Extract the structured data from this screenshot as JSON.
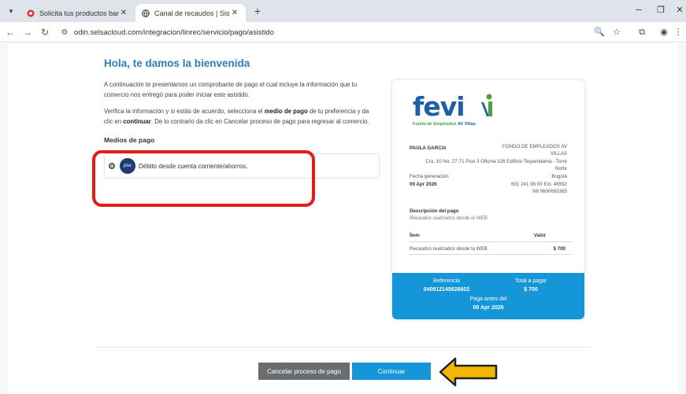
{
  "browser": {
    "tabs": [
      {
        "title": "Solicita tus productos bancarios",
        "active": false
      },
      {
        "title": "Canal de recaudos | Sistemas E",
        "active": true
      }
    ],
    "url": "odin.selsacloud.com/integracion/linrec/servicio/pago/asistido"
  },
  "page": {
    "welcome": "Hola, te damos la bienvenida",
    "intro": "A continuación te presentamos un comprobante de pago el cual incluye la información que tu comercio nos entregó para poder iniciar este asistido.",
    "instruction": {
      "part1": "Verifica la información y si estás de acuerdo, selecciona el ",
      "medio": "medio de pago",
      "part2": " de tu preferencia y da clic en ",
      "continuar": "continuar",
      "part3": ". De lo contrario da clic en Cancelar proceso de pago para regresar al comercio."
    },
    "payment_methods_title": "Medios de pago",
    "payment_method": {
      "logo_text": "pse",
      "label": "Débito desde cuenta corriente/ahorros."
    }
  },
  "receipt": {
    "logo_word": "fevi",
    "logo_sub_green": "Fondo de Empleados",
    "logo_sub_blue": "AV Villas",
    "payer_name": "PAULA GARCIA",
    "company_name_1": "FONDO DE EMPLEADOS AV",
    "company_name_2": "VILLAS",
    "address_1": "Cra. 10 No. 27-71 Piso 3 Oficina 326 Edificio Tequendama - Torre",
    "address_2": "Norte",
    "generation_label": "Fecha generación",
    "city": "Bogotá",
    "generation_date": "09 Apr 2026",
    "phone": "601 241 96 00 Ext. 46592",
    "nit": "Nit 0600693365",
    "description_label": "Descripción del pago",
    "description_value": "Recaudos realizados desde la WEB",
    "item_header": "Ítem",
    "value_header": "Valor",
    "item_name": "Recaudos realizados desde la WEB",
    "item_value": "$ 700",
    "reference_label": "Referencia",
    "reference_value": "040912145626602",
    "total_label": "Total a pagar",
    "total_value": "$ 700",
    "pay_before_label": "Paga antes del",
    "pay_before_date": "09 Apr 2026"
  },
  "actions": {
    "cancel_label": "Cancelar proceso de pago",
    "continue_label": "Continuar"
  },
  "colors": {
    "accent": "#1496d8",
    "title": "#2a7fba",
    "highlight": "#e21b1b",
    "arrow": "#f2b705"
  }
}
